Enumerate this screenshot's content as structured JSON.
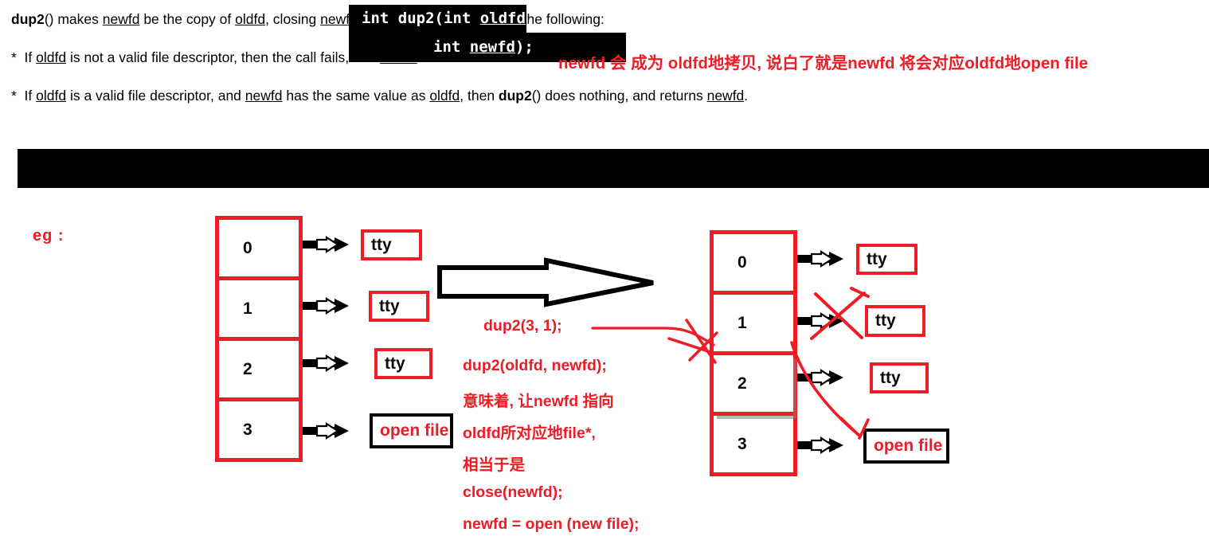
{
  "signature": {
    "line1": "int dup2(int oldfd,",
    "line2": "int newfd);",
    "underlined1": "oldfd",
    "underlined2": "newfd"
  },
  "top_note": "newfd 会 成为 oldfd地拷贝, 说白了就是newfd 将会对应oldfd地open file",
  "manpage": {
    "line1": "dup2() makes newfd be the copy of oldfd, closing newfd first if necessary, but note the following:",
    "line2": "*  If oldfd is not a valid file descriptor, then the call fails, and newfd is not closed.",
    "line3": "*  If oldfd is a valid file descriptor, and newfd has the same value as oldfd, then dup2() does nothing, and returns newfd."
  },
  "eg_label": "eg :",
  "left_table": {
    "rows": [
      {
        "fd": "0",
        "target": "tty",
        "target_kind": "tty"
      },
      {
        "fd": "1",
        "target": "tty",
        "target_kind": "tty"
      },
      {
        "fd": "2",
        "target": "tty",
        "target_kind": "tty"
      },
      {
        "fd": "3",
        "target": "open file",
        "target_kind": "open-file"
      }
    ]
  },
  "right_table": {
    "rows": [
      {
        "fd": "0",
        "target": "tty",
        "target_kind": "tty"
      },
      {
        "fd": "1",
        "target": "tty",
        "target_kind": "tty",
        "crossed_out": true
      },
      {
        "fd": "2",
        "target": "tty",
        "target_kind": "tty"
      },
      {
        "fd": "3",
        "target": "open file",
        "target_kind": "open-file"
      }
    ]
  },
  "annotation": {
    "call": "dup2(3, 1);",
    "lines": [
      "dup2(oldfd, newfd);",
      "意味着, 让newfd 指向",
      "oldfd所对应地file*,",
      "相当于是",
      "close(newfd);",
      "newfd = open (new file);"
    ]
  },
  "colors": {
    "red": "#ee1c25",
    "black": "#000000",
    "terminal_bg": "#000000",
    "terminal_fg": "#ffffff"
  }
}
